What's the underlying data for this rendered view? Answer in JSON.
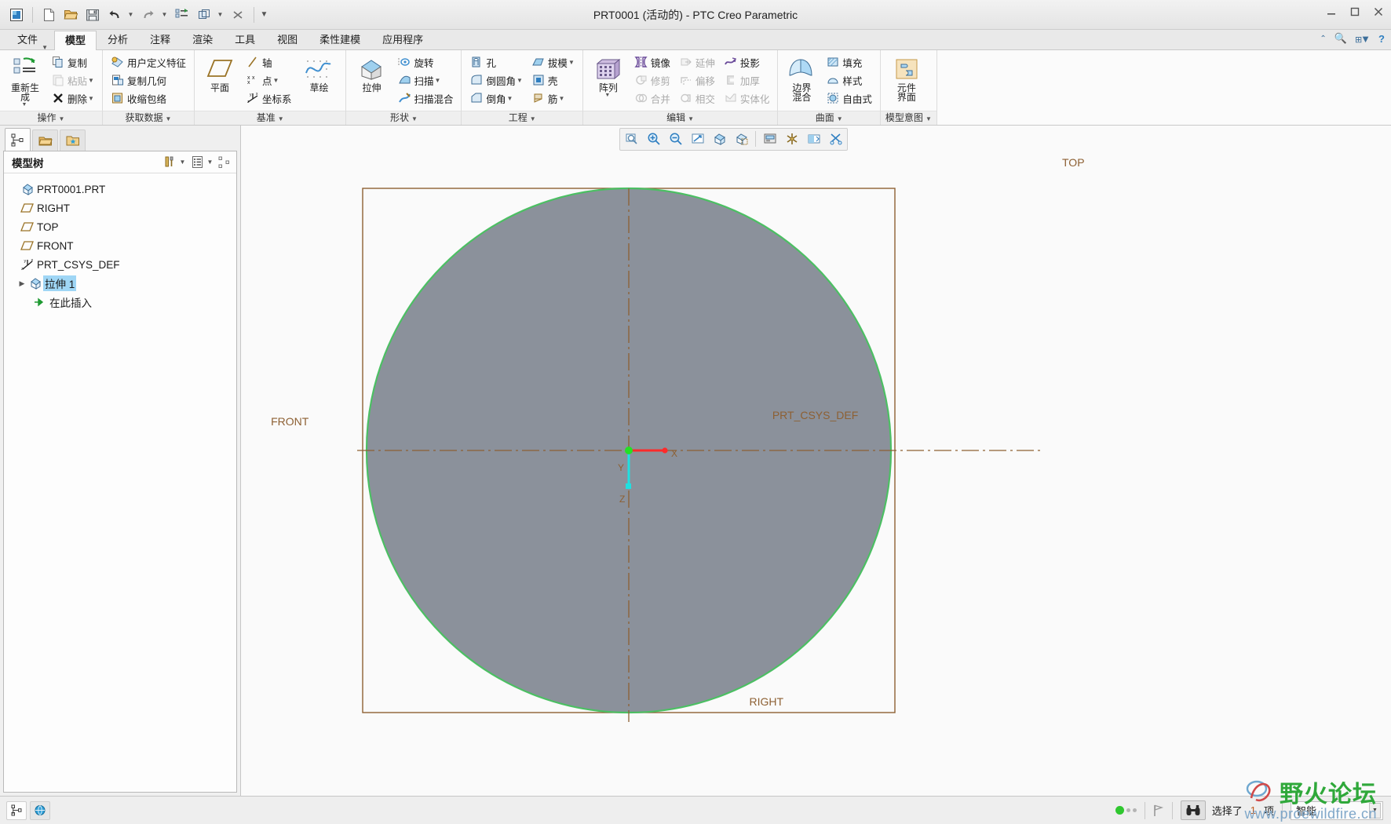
{
  "window": {
    "title": "PRT0001 (活动的) - PTC Creo Parametric",
    "minimize": "—",
    "maximize": "▢",
    "close": "✕"
  },
  "quick_access": {
    "items": [
      {
        "name": "app-icon",
        "glyph": "▣"
      },
      {
        "name": "new-file-icon",
        "glyph": "📄"
      },
      {
        "name": "open-file-icon",
        "glyph": "📂"
      },
      {
        "name": "save-icon",
        "glyph": "💾"
      },
      {
        "name": "undo-icon",
        "glyph": "↺"
      },
      {
        "name": "redo-icon",
        "glyph": "↻"
      },
      {
        "name": "regenerate-icon",
        "glyph": "≣"
      },
      {
        "name": "window-icon",
        "glyph": "❐"
      },
      {
        "name": "close-window-icon",
        "glyph": "✕"
      },
      {
        "name": "customize-icon",
        "glyph": "▾"
      }
    ]
  },
  "tabs": [
    {
      "label": "文件",
      "active": false,
      "has_caret": true
    },
    {
      "label": "模型",
      "active": true,
      "has_caret": false
    },
    {
      "label": "分析",
      "active": false,
      "has_caret": false
    },
    {
      "label": "注释",
      "active": false,
      "has_caret": false
    },
    {
      "label": "渲染",
      "active": false,
      "has_caret": false
    },
    {
      "label": "工具",
      "active": false,
      "has_caret": false
    },
    {
      "label": "视图",
      "active": false,
      "has_caret": false
    },
    {
      "label": "柔性建模",
      "active": false,
      "has_caret": false
    },
    {
      "label": "应用程序",
      "active": false,
      "has_caret": false
    }
  ],
  "tab_right_icons": [
    {
      "name": "minimize-ribbon-icon",
      "glyph": "⌃"
    },
    {
      "name": "search-icon",
      "glyph": "🔍"
    },
    {
      "name": "options-icon",
      "glyph": "⌨"
    },
    {
      "name": "help-icon",
      "glyph": "?"
    }
  ],
  "ribbon": {
    "groups": [
      {
        "label": "操作",
        "big": [
          {
            "label_line1": "重新生成",
            "label_line2": "",
            "icon": "regenerate-icon",
            "caret": true
          }
        ],
        "small": [
          {
            "label": "复制",
            "icon": "copy-icon",
            "caret": false,
            "disabled": false
          },
          {
            "label": "粘贴",
            "icon": "paste-icon",
            "caret": true,
            "disabled": true
          },
          {
            "label": "删除",
            "icon": "delete-icon",
            "caret": true,
            "disabled": false
          }
        ]
      },
      {
        "label": "获取数据",
        "big": [],
        "small": [
          {
            "label": "用户定义特征",
            "icon": "udf-icon",
            "caret": false,
            "disabled": false
          },
          {
            "label": "复制几何",
            "icon": "copy-geometry-icon",
            "caret": false,
            "disabled": false
          },
          {
            "label": "收缩包络",
            "icon": "shrinkwrap-icon",
            "caret": false,
            "disabled": false
          }
        ]
      },
      {
        "label": "基准",
        "big": [
          {
            "label_line1": "平面",
            "label_line2": "",
            "icon": "datum-plane-icon",
            "caret": false
          }
        ],
        "small": [
          {
            "label": "轴",
            "icon": "datum-axis-icon",
            "caret": false,
            "disabled": false
          },
          {
            "label": "点",
            "icon": "datum-point-icon",
            "caret": true,
            "disabled": false
          },
          {
            "label": "坐标系",
            "icon": "coordinate-system-icon",
            "caret": false,
            "disabled": false
          }
        ],
        "big2": [
          {
            "label_line1": "草绘",
            "label_line2": "",
            "icon": "sketch-icon",
            "caret": false
          }
        ]
      },
      {
        "label": "形状",
        "big": [
          {
            "label_line1": "拉伸",
            "label_line2": "",
            "icon": "extrude-icon",
            "caret": false
          }
        ],
        "small": [
          {
            "label": "旋转",
            "icon": "revolve-icon",
            "caret": false,
            "disabled": false
          },
          {
            "label": "扫描",
            "icon": "sweep-icon",
            "caret": true,
            "disabled": false
          },
          {
            "label": "扫描混合",
            "icon": "swept-blend-icon",
            "caret": false,
            "disabled": false
          }
        ]
      },
      {
        "label": "工程",
        "big": [],
        "small": [
          {
            "label": "孔",
            "icon": "hole-icon",
            "caret": false,
            "disabled": false
          },
          {
            "label": "倒圆角",
            "icon": "round-icon",
            "caret": true,
            "disabled": false
          },
          {
            "label": "倒角",
            "icon": "chamfer-icon",
            "caret": true,
            "disabled": false
          }
        ],
        "small2": [
          {
            "label": "拔模",
            "icon": "draft-icon",
            "caret": true,
            "disabled": false
          },
          {
            "label": "壳",
            "icon": "shell-icon",
            "caret": false,
            "disabled": false
          },
          {
            "label": "筋",
            "icon": "rib-icon",
            "caret": true,
            "disabled": false
          }
        ]
      },
      {
        "label": "编辑",
        "big": [
          {
            "label_line1": "阵列",
            "label_line2": "",
            "icon": "pattern-icon",
            "caret": true
          }
        ],
        "small": [
          {
            "label": "镜像",
            "icon": "mirror-icon",
            "caret": false,
            "disabled": false
          },
          {
            "label": "修剪",
            "icon": "trim-icon",
            "caret": false,
            "disabled": true
          },
          {
            "label": "合并",
            "icon": "merge-icon",
            "caret": false,
            "disabled": true
          }
        ],
        "small2": [
          {
            "label": "延伸",
            "icon": "extend-icon",
            "caret": false,
            "disabled": true
          },
          {
            "label": "偏移",
            "icon": "offset-icon",
            "caret": false,
            "disabled": true
          },
          {
            "label": "相交",
            "icon": "intersect-icon",
            "caret": false,
            "disabled": true
          }
        ],
        "small3": [
          {
            "label": "投影",
            "icon": "project-icon",
            "caret": false,
            "disabled": false
          },
          {
            "label": "加厚",
            "icon": "thicken-icon",
            "caret": false,
            "disabled": true
          },
          {
            "label": "实体化",
            "icon": "solidify-icon",
            "caret": false,
            "disabled": true
          }
        ]
      },
      {
        "label": "曲面",
        "big": [
          {
            "label_line1": "边界",
            "label_line2": "混合",
            "icon": "boundary-blend-icon",
            "caret": false
          }
        ],
        "small": [
          {
            "label": "填充",
            "icon": "fill-icon",
            "caret": false,
            "disabled": false
          },
          {
            "label": "样式",
            "icon": "style-icon",
            "caret": false,
            "disabled": false
          },
          {
            "label": "自由式",
            "icon": "freestyle-icon",
            "caret": false,
            "disabled": false
          }
        ]
      },
      {
        "label": "模型意图",
        "big": [
          {
            "label_line1": "元件",
            "label_line2": "界面",
            "icon": "component-interface-icon",
            "caret": false
          }
        ],
        "small": []
      }
    ]
  },
  "sidebar": {
    "nav_tabs": [
      {
        "name": "model-tree-tab",
        "glyph": "⊹",
        "active": true
      },
      {
        "name": "folder-browser-tab",
        "glyph": "🗀",
        "active": false
      },
      {
        "name": "favorites-tab",
        "glyph": "★",
        "active": false
      }
    ],
    "tree_header": {
      "title": "模型树",
      "settings_icon": "tools-icon",
      "display_icon": "display-settings-icon",
      "extra_icon": "tree-columns-icon"
    },
    "tree_items": [
      {
        "label": "PRT0001.PRT",
        "icon": "part-icon",
        "indent": 0,
        "expander": "",
        "selected": false
      },
      {
        "label": "RIGHT",
        "icon": "datum-plane-icon",
        "indent": 1,
        "expander": "",
        "selected": false
      },
      {
        "label": "TOP",
        "icon": "datum-plane-icon",
        "indent": 1,
        "expander": "",
        "selected": false
      },
      {
        "label": "FRONT",
        "icon": "datum-plane-icon",
        "indent": 1,
        "expander": "",
        "selected": false
      },
      {
        "label": "PRT_CSYS_DEF",
        "icon": "coordinate-system-icon",
        "indent": 1,
        "expander": "",
        "selected": false
      },
      {
        "label": "拉伸 1",
        "icon": "extrude-feature-icon",
        "indent": 1,
        "expander": "▶",
        "selected": true
      },
      {
        "label": "在此插入",
        "icon": "insert-here-icon",
        "indent": 1,
        "expander": "",
        "selected": false
      }
    ],
    "foot_buttons": [
      {
        "name": "model-tree-toggle",
        "glyph": "⊹",
        "active": true
      },
      {
        "name": "layer-tree-toggle",
        "glyph": "◉",
        "active": false
      }
    ]
  },
  "graphics_toolbar": [
    {
      "name": "refit-icon",
      "glyph": "⌕"
    },
    {
      "name": "zoom-in-icon",
      "glyph": "⊕"
    },
    {
      "name": "zoom-out-icon",
      "glyph": "⊖"
    },
    {
      "name": "repaint-icon",
      "glyph": "⬀"
    },
    {
      "name": "datum-display-icon",
      "glyph": "◰"
    },
    {
      "name": "datum-plane-display-icon",
      "glyph": "◱"
    },
    {
      "name": "saved-views-icon",
      "glyph": "▤"
    },
    {
      "name": "view-manager-icon",
      "glyph": "✳"
    },
    {
      "name": "display-style-icon",
      "glyph": "◧"
    },
    {
      "name": "appearance-gallery-icon",
      "glyph": "✂"
    }
  ],
  "viewport": {
    "labels": [
      {
        "text": "TOP",
        "name": "datum-label-top"
      },
      {
        "text": "FRONT",
        "name": "datum-label-front"
      },
      {
        "text": "RIGHT",
        "name": "datum-label-right"
      },
      {
        "text": "PRT_CSYS_DEF",
        "name": "csys-label"
      }
    ],
    "colors": {
      "solid_fill": "#8b919b",
      "solid_edge": "#4cbf63",
      "datum_line": "#8d6033",
      "x_axis": "#ff2a2a",
      "z_axis": "#1fe0e0",
      "origin": "#25e025",
      "background": "#fafafa"
    },
    "axis_labels": {
      "x": "X",
      "y": "Y",
      "z": "Z"
    }
  },
  "statusbar": {
    "left_buttons": [
      {
        "name": "model-tree-panel-toggle",
        "glyph": "⊹",
        "active": true
      },
      {
        "name": "browser-panel-toggle",
        "glyph": "◉",
        "active": false
      }
    ],
    "flag_icon": "flag-icon",
    "search_icon": "binoculars-icon",
    "selection_text_prefix": "选择了",
    "selection_count": "1",
    "selection_text_suffix": "项",
    "filter_label": "智能",
    "filter_caret": "▾"
  },
  "watermark": {
    "line1": "野火论坛",
    "line2": "www.proewildfire.cn"
  }
}
